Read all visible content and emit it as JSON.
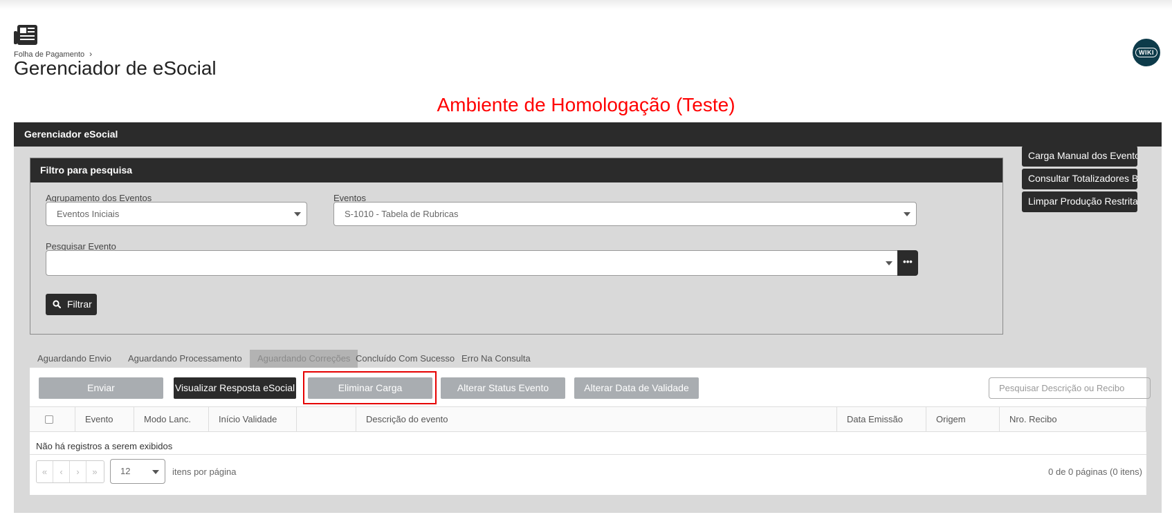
{
  "breadcrumb": {
    "item": "Folha de Pagamento",
    "separator": "›"
  },
  "page_title": "Gerenciador de eSocial",
  "wiki_label": "WIKI",
  "environment_banner": "Ambiente de Homologação (Teste)",
  "panel_title": "Gerenciador eSocial",
  "filter": {
    "title": "Filtro para pesquisa",
    "grouping_label": "Agrupamento dos Eventos",
    "grouping_value": "Eventos Iniciais",
    "events_label": "Eventos",
    "events_value": "S-1010 - Tabela de Rubricas",
    "search_label": "Pesquisar Evento",
    "search_value": "",
    "more_button": "•••",
    "filter_button": "Filtrar"
  },
  "side_actions": {
    "manual_load": "Carga Manual dos Eventos",
    "totalizers": "Consultar Totalizadores Base",
    "clear_restricted": "Limpar Produção Restrita"
  },
  "tabs": [
    "Aguardando Envio",
    "Aguardando Processamento",
    "Aguardando Correções",
    "Concluído Com Sucesso",
    "Erro Na Consulta"
  ],
  "active_tab": "Aguardando Correções",
  "grid_actions": {
    "send": "Enviar",
    "view_response": "Visualizar Resposta eSocial",
    "eliminate_load": "Eliminar Carga",
    "change_status": "Alterar Status Evento",
    "change_validity": "Alterar Data de Validade",
    "search_placeholder": "Pesquisar Descrição ou Recibo"
  },
  "table": {
    "columns": [
      "Evento",
      "Modo Lanc.",
      "Início Validade",
      "",
      "Descrição do evento",
      "Data Emissão",
      "Origem",
      "Nro. Recibo"
    ],
    "empty_message": "Não há registros a serem exibidos"
  },
  "pager": {
    "first": "«",
    "prev": "‹",
    "next": "›",
    "last": "»",
    "page_size": "12",
    "items_per_page": "itens por página",
    "info": "0 de 0 páginas (0 itens)"
  },
  "colors": {
    "header_dark": "#2b2b2b",
    "panel_bg": "#d9d9d9",
    "banner_red": "#ff0000",
    "highlight_red": "#e60000",
    "button_gray": "#a9adb1"
  }
}
